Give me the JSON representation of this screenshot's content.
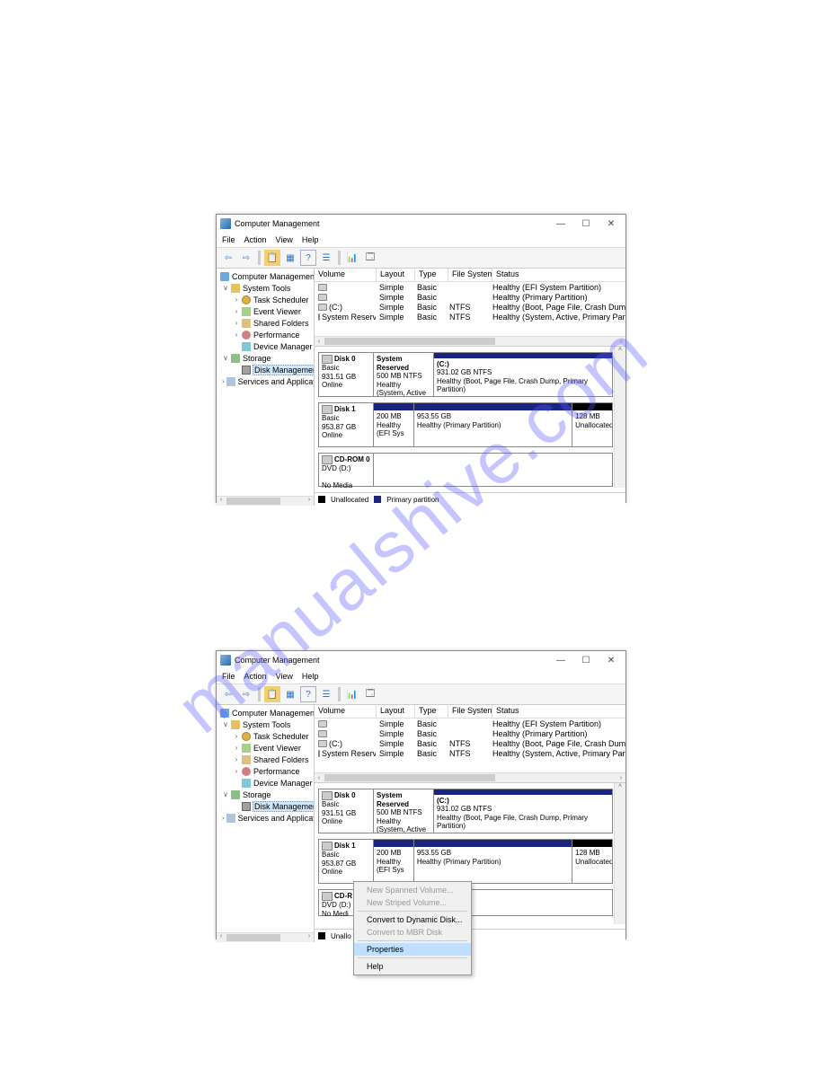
{
  "watermark": "manualshive.com",
  "window": {
    "title": "Computer Management",
    "menus": [
      "File",
      "Action",
      "View",
      "Help"
    ],
    "toolbar_icons": [
      "back",
      "forward",
      "up",
      "props",
      "list",
      "help",
      "sep",
      "settings",
      "refresh"
    ]
  },
  "tree": {
    "root": "Computer Management (Lo",
    "system_tools": "System Tools",
    "items_tools": [
      "Task Scheduler",
      "Event Viewer",
      "Shared Folders",
      "Performance",
      "Device Manager"
    ],
    "storage": "Storage",
    "disk_mgmt": "Disk Management",
    "services": "Services and Application"
  },
  "vol_header": {
    "volume": "Volume",
    "layout": "Layout",
    "type": "Type",
    "fs": "File System",
    "status": "Status"
  },
  "volumes": [
    {
      "name": "",
      "layout": "Simple",
      "type": "Basic",
      "fs": "",
      "status": "Healthy (EFI System Partition)"
    },
    {
      "name": "",
      "layout": "Simple",
      "type": "Basic",
      "fs": "",
      "status": "Healthy (Primary Partition)"
    },
    {
      "name": "(C:)",
      "layout": "Simple",
      "type": "Basic",
      "fs": "NTFS",
      "status": "Healthy (Boot, Page File, Crash Dump, Primary Partition)"
    },
    {
      "name": "System Reserved",
      "layout": "Simple",
      "type": "Basic",
      "fs": "NTFS",
      "status": "Healthy (System, Active, Primary Partition)"
    }
  ],
  "disks": [
    {
      "label": "Disk 0",
      "kind": "Basic",
      "size": "931.51 GB",
      "state": "Online",
      "parts": [
        {
          "title": "System Reserved",
          "sub": "500 MB NTFS",
          "health": "Healthy (System, Active",
          "bar": "primary",
          "grow": 1
        },
        {
          "title": "(C:)",
          "sub": "931.02 GB NTFS",
          "health": "Healthy (Boot, Page File, Crash Dump, Primary Partition)",
          "bar": "primary",
          "grow": 3
        }
      ]
    },
    {
      "label": "Disk 1",
      "kind": "Basic",
      "size": "953.87 GB",
      "state": "Online",
      "parts": [
        {
          "title": "",
          "sub": "200 MB",
          "health": "Healthy (EFI Sys",
          "bar": "primary",
          "grow": 1
        },
        {
          "title": "",
          "sub": "953.55 GB",
          "health": "Healthy (Primary Partition)",
          "bar": "primary",
          "grow": 4
        },
        {
          "title": "",
          "sub": "128 MB",
          "health": "Unallocated",
          "bar": "unalloc",
          "grow": 1
        }
      ]
    }
  ],
  "cdrom": {
    "label": "CD-ROM 0",
    "sub": "DVD (D:)",
    "state": "No Media"
  },
  "legend": {
    "unalloc": "Unallocated",
    "primary": "Primary partition"
  },
  "context_menu": {
    "items": [
      {
        "label": "New Spanned Volume...",
        "disabled": true
      },
      {
        "label": "New Striped Volume...",
        "disabled": true
      },
      {
        "sep": true
      },
      {
        "label": "Convert to Dynamic Disk...",
        "disabled": false
      },
      {
        "label": "Convert to MBR Disk",
        "disabled": true
      },
      {
        "sep": true
      },
      {
        "label": "Properties",
        "highlight": true
      },
      {
        "sep": true
      },
      {
        "label": "Help",
        "disabled": false
      }
    ]
  }
}
